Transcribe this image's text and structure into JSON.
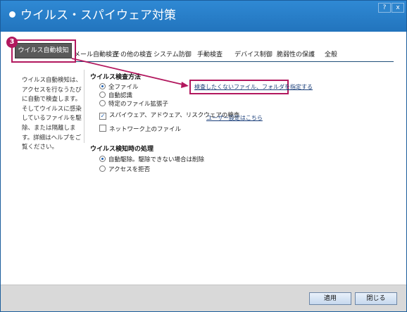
{
  "window": {
    "title": "ウイルス・スパイウェア対策",
    "help_label": "?",
    "close_label": "x"
  },
  "tabs": [
    {
      "label": "ウイルス自動検知",
      "active": true
    },
    {
      "label": "メール自動検査"
    },
    {
      "label": "その他の検査"
    },
    {
      "label": "システム防御"
    },
    {
      "label": "手動検査"
    },
    {
      "label": "デバイス制御"
    },
    {
      "label": "脆弱性の保護"
    },
    {
      "label": "全般"
    }
  ],
  "callout": {
    "number": "3",
    "color": "#b2185e"
  },
  "help_text": "ウイルス自動検知は、アクセスを行なうたびに自動で検査します。そしてウイルスに感染しているファイルを駆除、または隔離します。詳細はヘルプをご覧ください。",
  "scan_method": {
    "title": "ウイルス検査方法",
    "options": [
      {
        "label": "全ファイル",
        "selected": true
      },
      {
        "label": "自動認識",
        "selected": false
      },
      {
        "label": "特定のファイル拡張子",
        "selected": false
      }
    ],
    "exclude_link": "検査したくないファイル、フォルダを指定する",
    "spyware_check": {
      "label": "スパイウェア、アドウェア、リスクウェアの検査",
      "checked": true
    },
    "user_setting_link": "ユーザー設定はこちら",
    "network_check": {
      "label": "ネットワーク上のファイル",
      "checked": false
    }
  },
  "on_detect": {
    "title": "ウイルス検知時の処理",
    "options": [
      {
        "label": "自動駆除。駆除できない場合は削除",
        "selected": true
      },
      {
        "label": "アクセスを拒否",
        "selected": false
      }
    ]
  },
  "footer": {
    "apply_label": "適用",
    "close_label": "閉じる"
  }
}
